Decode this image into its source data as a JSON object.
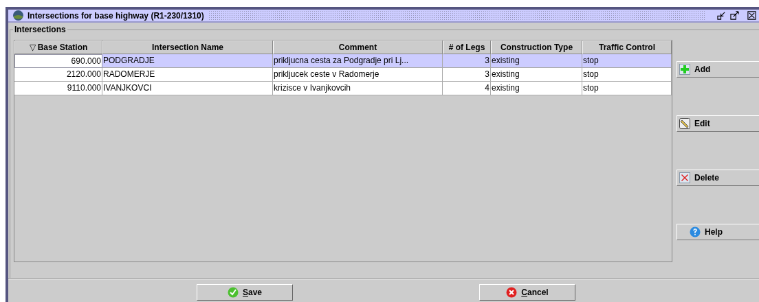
{
  "window": {
    "title": "Intersections for base highway (R1-230/1310)"
  },
  "group": {
    "title": "Intersections"
  },
  "table": {
    "columns": [
      {
        "label": "Base Station",
        "sort_mark": "▽",
        "kind": "number"
      },
      {
        "label": "Intersection Name",
        "kind": "text"
      },
      {
        "label": "Comment",
        "kind": "text"
      },
      {
        "label": "# of Legs",
        "kind": "number"
      },
      {
        "label": "Construction Type",
        "kind": "text"
      },
      {
        "label": "Traffic Control",
        "kind": "text"
      }
    ],
    "rows": [
      {
        "selected": true,
        "cells": [
          "690.000",
          "PODGRADJE",
          "prikljucna cesta za Podgradje pri Lj...",
          "3",
          "existing",
          "stop"
        ]
      },
      {
        "selected": false,
        "cells": [
          "2120.000",
          "RADOMERJE",
          "prikljucek ceste v Radomerje",
          "3",
          "existing",
          "stop"
        ]
      },
      {
        "selected": false,
        "cells": [
          "9110.000",
          "IVANJKOVCI",
          "krizisce v Ivanjkovcih",
          "4",
          "existing",
          "stop"
        ]
      }
    ]
  },
  "side_buttons": [
    {
      "label": "Add",
      "kind": "add"
    },
    {
      "label": "Edit",
      "kind": "edit"
    },
    {
      "label": "Delete",
      "kind": "delete"
    },
    {
      "label": "Help",
      "kind": "help"
    }
  ],
  "footer_buttons": [
    {
      "label": "Save",
      "kind": "save",
      "underline_first": true
    },
    {
      "label": "Cancel",
      "kind": "cancel",
      "underline_first": true
    }
  ]
}
